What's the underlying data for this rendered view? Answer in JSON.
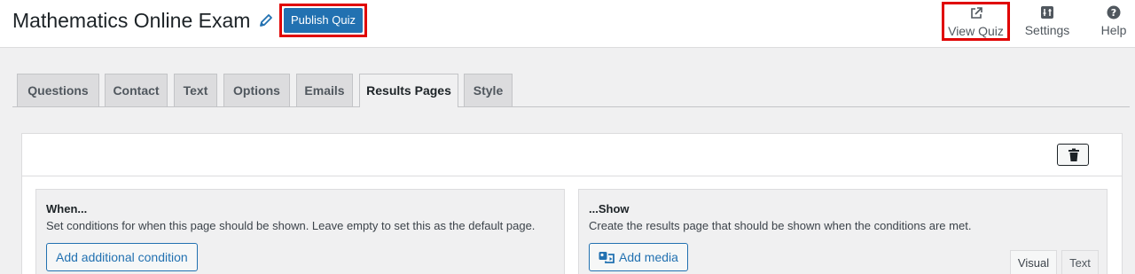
{
  "header": {
    "title": "Mathematics Online Exam",
    "publish_label": "Publish Quiz",
    "view_quiz_label": "View Quiz",
    "settings_label": "Settings",
    "help_label": "Help"
  },
  "tabs": [
    {
      "label": "Questions"
    },
    {
      "label": "Contact"
    },
    {
      "label": "Text"
    },
    {
      "label": "Options"
    },
    {
      "label": "Emails"
    },
    {
      "label": "Results Pages",
      "active": true
    },
    {
      "label": "Style"
    }
  ],
  "results_page": {
    "when": {
      "heading": "When...",
      "description": "Set conditions for when this page should be shown. Leave empty to set this as the default page.",
      "add_condition_label": "Add additional condition"
    },
    "show": {
      "heading": "...Show",
      "description": "Create the results page that should be shown when the conditions are met.",
      "add_media_label": "Add media",
      "visual_tab_label": "Visual",
      "text_tab_label": "Text"
    }
  },
  "colors": {
    "primary": "#2271b1",
    "highlight": "#e00000"
  },
  "icons": {
    "edit": "pencil-icon",
    "view_quiz": "external-link-icon",
    "settings": "settings-icon",
    "help": "help-icon",
    "delete": "trash-icon",
    "media": "media-icon"
  }
}
